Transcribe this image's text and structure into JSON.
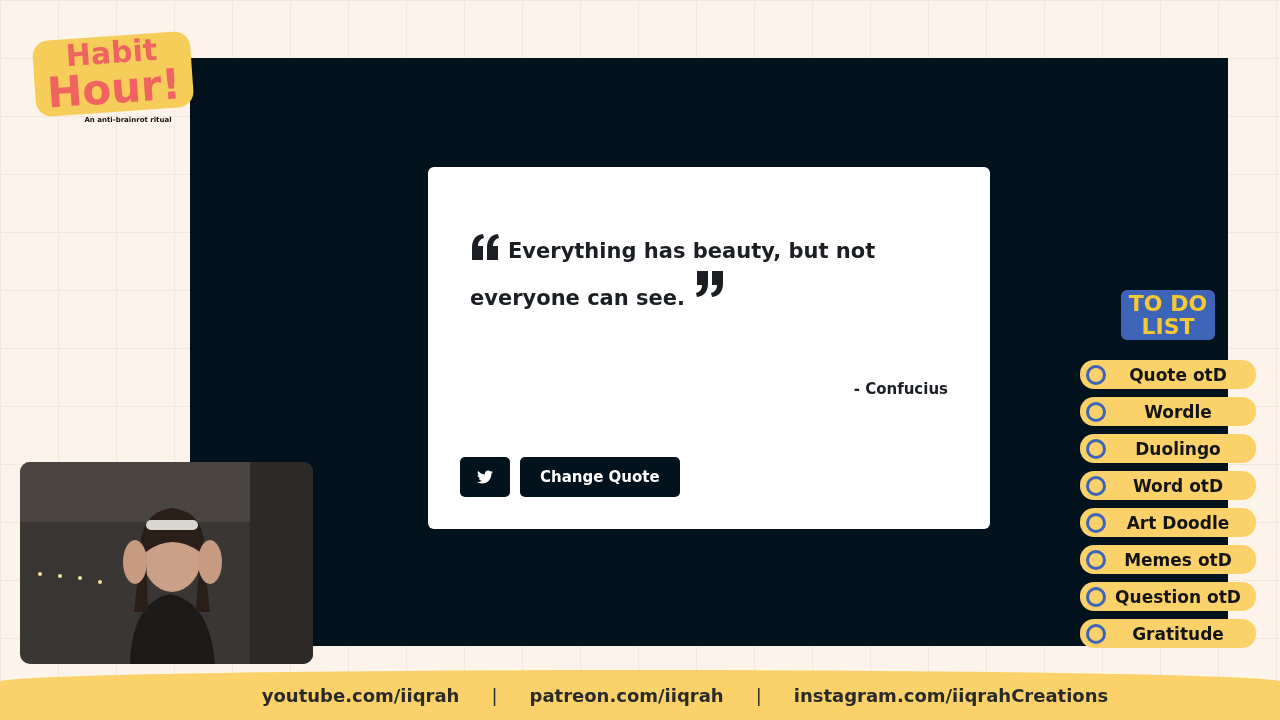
{
  "logo": {
    "title_lines": [
      "Habit",
      "Hour!"
    ],
    "tagline": "An anti-brainrot ritual"
  },
  "shared_screen": {
    "quote_card": {
      "quote": "Everything has beauty, but not everyone can see.",
      "author": "- Confucius",
      "buttons": [
        {
          "kind": "tweet"
        },
        {
          "kind": "text",
          "label": "Change Quote"
        }
      ]
    }
  },
  "todo": {
    "title_lines": [
      "TO DO",
      "LIST"
    ],
    "items": [
      {
        "label": "Quote otD",
        "checked": false
      },
      {
        "label": "Wordle",
        "checked": false
      },
      {
        "label": "Duolingo",
        "checked": false
      },
      {
        "label": "Word otD",
        "checked": false
      },
      {
        "label": "Art Doodle",
        "checked": false
      },
      {
        "label": "Memes otD",
        "checked": false
      },
      {
        "label": "Question otD",
        "checked": false
      },
      {
        "label": "Gratitude",
        "checked": false
      }
    ]
  },
  "footer": [
    {
      "kind": "link",
      "text": "youtube.com/iiqrah"
    },
    {
      "kind": "separator",
      "text": "|"
    },
    {
      "kind": "link",
      "text": "patreon.com/iiqrah"
    },
    {
      "kind": "separator",
      "text": "|"
    },
    {
      "kind": "link",
      "text": "instagram.com/iiqrahCreations"
    }
  ]
}
